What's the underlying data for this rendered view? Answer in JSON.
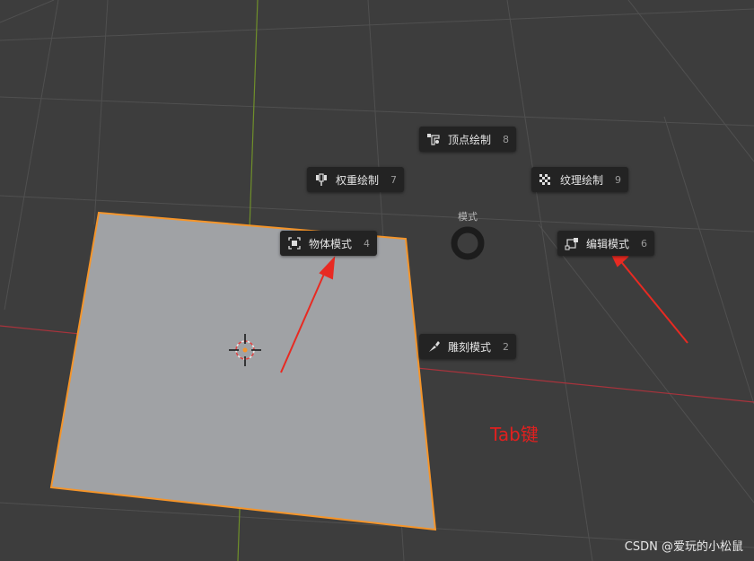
{
  "pie_menu": {
    "title": "模式",
    "items": [
      {
        "id": "vertex-paint",
        "label": "顶点绘制",
        "shortcut": "8",
        "icon": "vertex-paint-icon"
      },
      {
        "id": "weight-paint",
        "label": "权重绘制",
        "shortcut": "7",
        "icon": "weight-paint-icon"
      },
      {
        "id": "texture-paint",
        "label": "纹理绘制",
        "shortcut": "9",
        "icon": "texture-paint-icon"
      },
      {
        "id": "object-mode",
        "label": "物体模式",
        "shortcut": "4",
        "icon": "object-mode-icon"
      },
      {
        "id": "edit-mode",
        "label": "编辑模式",
        "shortcut": "6",
        "icon": "edit-mode-icon"
      },
      {
        "id": "sculpt-mode",
        "label": "雕刻模式",
        "shortcut": "2",
        "icon": "sculpt-mode-icon"
      }
    ]
  },
  "annotation": {
    "text": "Tab键",
    "color": "#e0201f"
  },
  "watermark": {
    "text": "CSDN @爱玩的小松鼠"
  },
  "colors": {
    "background": "#3d3d3d",
    "plane_fill": "#a0a2a5",
    "selection_outline": "#f5952a",
    "x_axis": "#a8333c",
    "y_axis": "#6f8f2a"
  }
}
